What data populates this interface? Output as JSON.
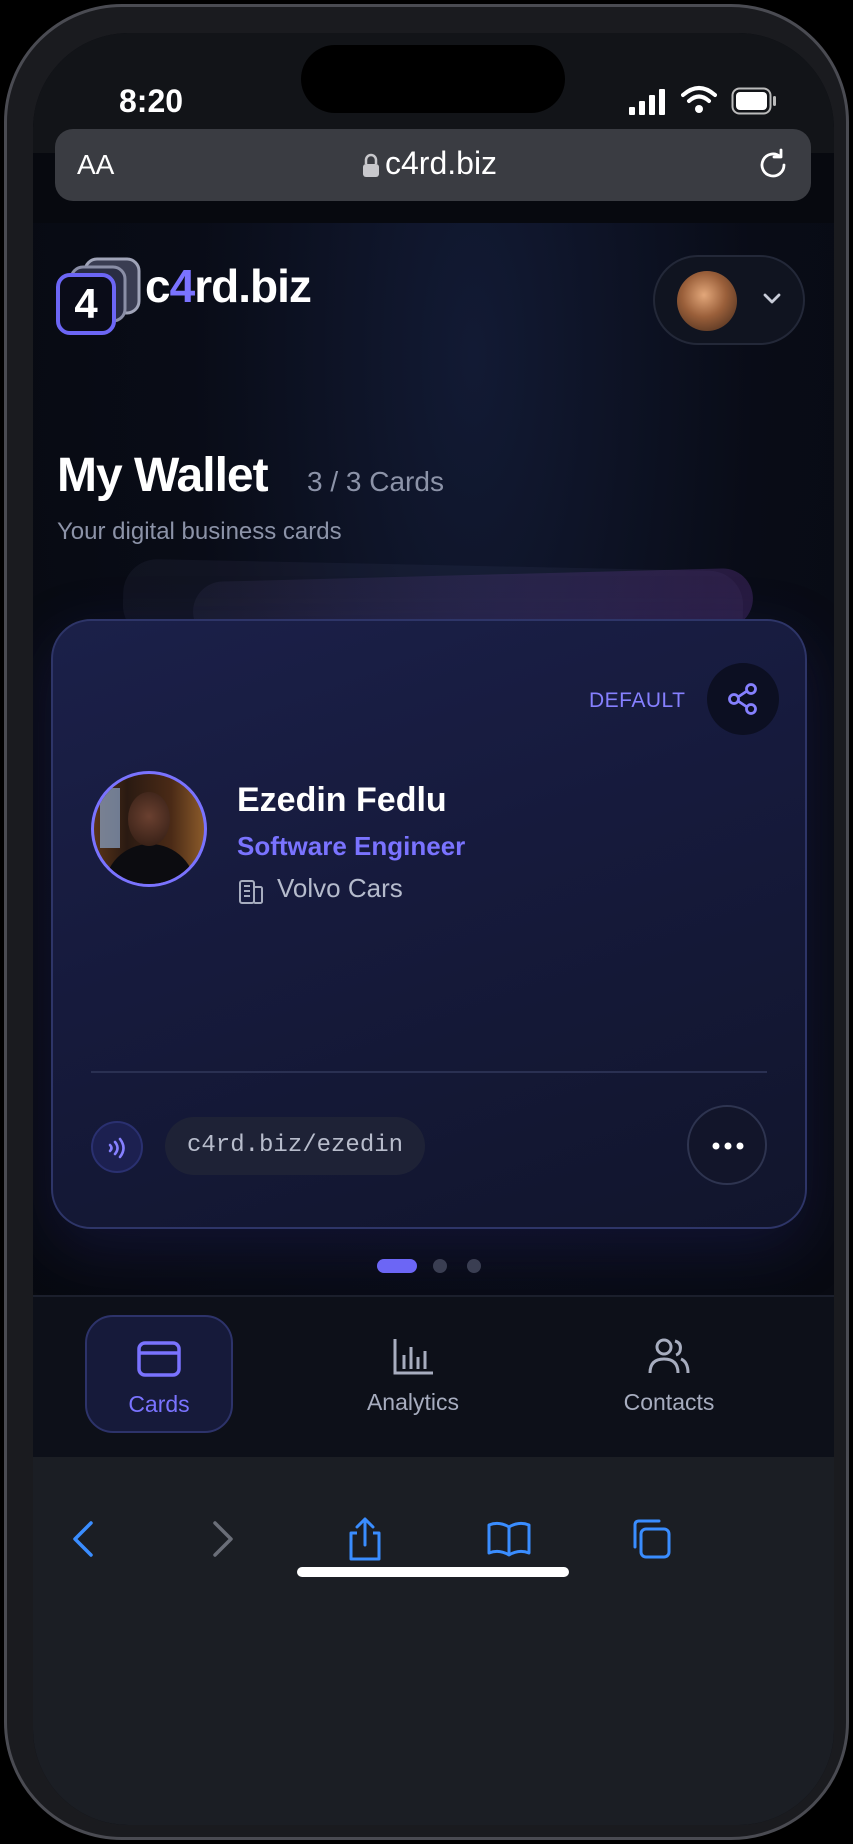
{
  "status_bar": {
    "time": "8:20"
  },
  "browser": {
    "text_size_label": "AA",
    "domain": "c4rd.biz"
  },
  "header": {
    "logo_mark": "4",
    "brand_prefix": "c",
    "brand_highlight": "4",
    "brand_suffix": "rd.biz"
  },
  "wallet": {
    "title": "My Wallet",
    "count": "3 / 3 Cards",
    "subtitle": "Your digital business cards"
  },
  "card": {
    "badge": "DEFAULT",
    "name": "Ezedin Fedlu",
    "role": "Software Engineer",
    "company": "Volvo Cars",
    "link": "c4rd.biz/ezedin"
  },
  "pagination": {
    "total": 3,
    "current": 1
  },
  "bottom_nav": {
    "items": [
      {
        "label": "Cards",
        "icon": "card-icon",
        "active": true
      },
      {
        "label": "Analytics",
        "icon": "bar-chart-icon",
        "active": false
      },
      {
        "label": "Contacts",
        "icon": "users-icon",
        "active": false
      }
    ]
  },
  "colors": {
    "accent": "#7a73ff",
    "fab": "#5a2ab0",
    "background": "#07090f",
    "safari_blue": "#3a8dff"
  }
}
